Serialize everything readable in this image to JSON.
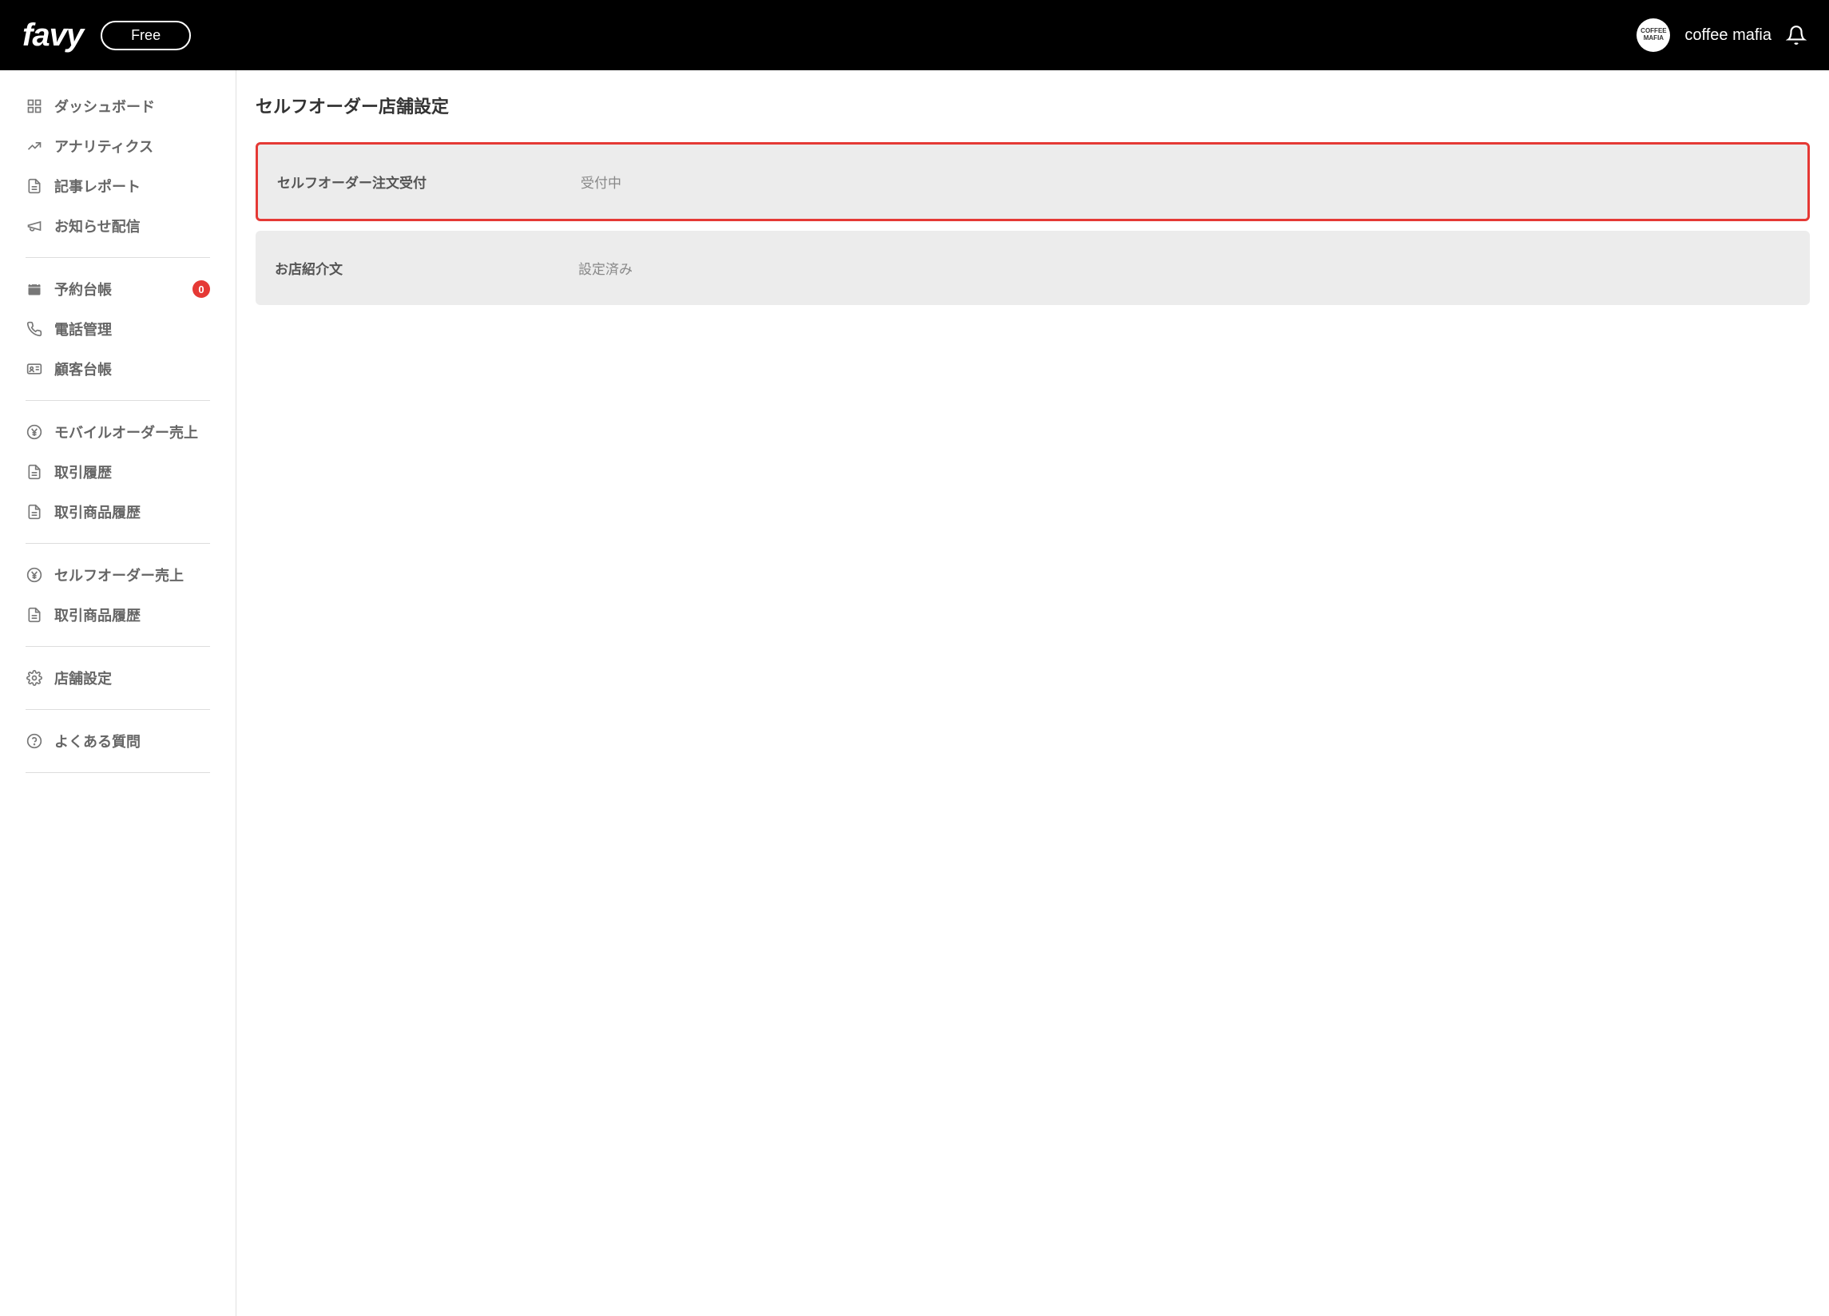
{
  "header": {
    "logo": "favy",
    "plan": "Free",
    "user_avatar_text": "COFFEE\nMAFIA",
    "user_name": "coffee mafia"
  },
  "sidebar": {
    "groups": [
      {
        "items": [
          {
            "icon": "dashboard",
            "label": "ダッシュボード"
          },
          {
            "icon": "analytics",
            "label": "アナリティクス"
          },
          {
            "icon": "report",
            "label": "記事レポート"
          },
          {
            "icon": "announce",
            "label": "お知らせ配信"
          }
        ]
      },
      {
        "items": [
          {
            "icon": "calendar",
            "label": "予約台帳",
            "badge": "0"
          },
          {
            "icon": "phone",
            "label": "電話管理"
          },
          {
            "icon": "id-card",
            "label": "顧客台帳"
          }
        ]
      },
      {
        "items": [
          {
            "icon": "yen",
            "label": "モバイルオーダー売上"
          },
          {
            "icon": "doc",
            "label": "取引履歴"
          },
          {
            "icon": "doc",
            "label": "取引商品履歴"
          }
        ]
      },
      {
        "items": [
          {
            "icon": "yen",
            "label": "セルフオーダー売上"
          },
          {
            "icon": "doc",
            "label": "取引商品履歴"
          }
        ]
      },
      {
        "items": [
          {
            "icon": "gear",
            "label": "店舗設定"
          }
        ]
      },
      {
        "items": [
          {
            "icon": "help",
            "label": "よくある質問"
          }
        ]
      }
    ]
  },
  "main": {
    "title": "セルフオーダー店舗設定",
    "cards": [
      {
        "label": "セルフオーダー注文受付",
        "status": "受付中",
        "highlight": true
      },
      {
        "label": "お店紹介文",
        "status": "設定済み",
        "highlight": false
      }
    ]
  }
}
